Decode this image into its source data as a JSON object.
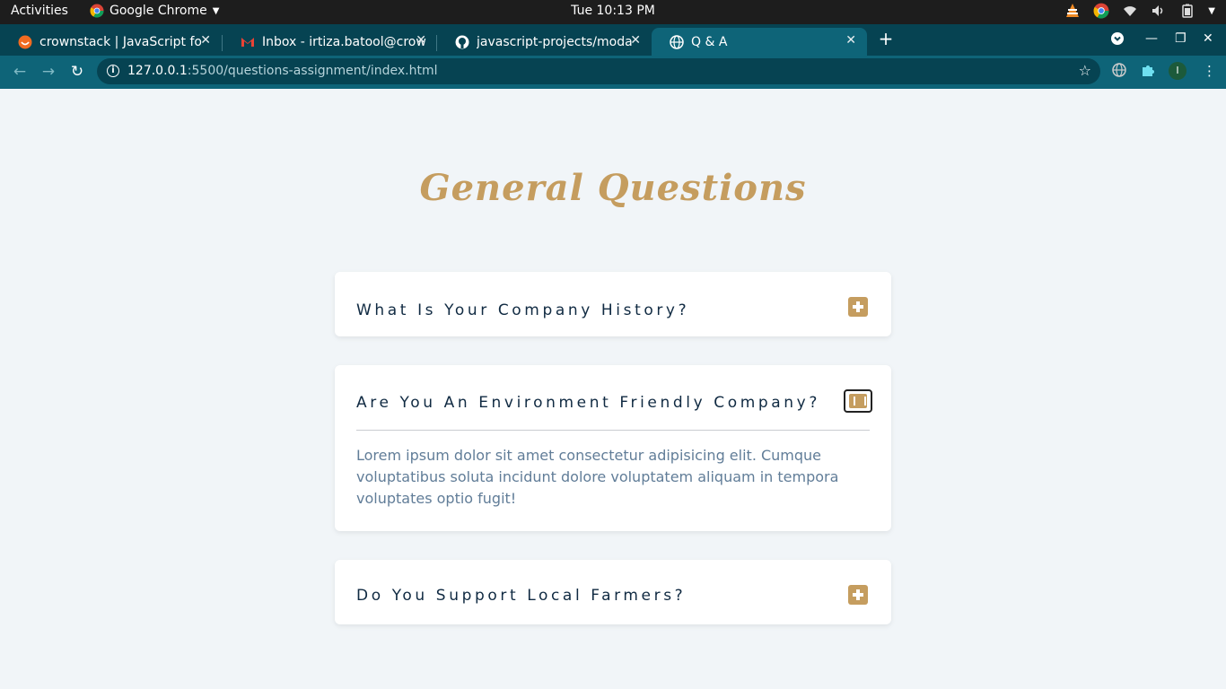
{
  "os": {
    "activities": "Activities",
    "app_name": "Google Chrome",
    "clock": "Tue 10:13 PM"
  },
  "browser": {
    "tabs": [
      {
        "title": "crownstack | JavaScript fo",
        "icon": "crownstack-favicon"
      },
      {
        "title": "Inbox - irtiza.batool@crow",
        "icon": "gmail-favicon"
      },
      {
        "title": "javascript-projects/moda",
        "icon": "github-favicon"
      },
      {
        "title": "Q & A",
        "icon": "globe-favicon",
        "active": true
      }
    ],
    "url_host": "127.0.0.1",
    "url_path": ":5500/questions-assignment/index.html",
    "profile_initial": "I"
  },
  "page": {
    "title": "General Questions",
    "accent_color": "#c59d5f",
    "questions": [
      {
        "question": "What Is Your Company History?",
        "expanded": false
      },
      {
        "question": "Are You An Environment Friendly Company?",
        "expanded": true,
        "answer": "Lorem ipsum dolor sit amet consectetur adipisicing elit. Cumque voluptatibus soluta incidunt dolore voluptatem aliquam in tempora voluptates optio fugit!"
      },
      {
        "question": "Do You Support Local Farmers?",
        "expanded": false
      }
    ]
  }
}
